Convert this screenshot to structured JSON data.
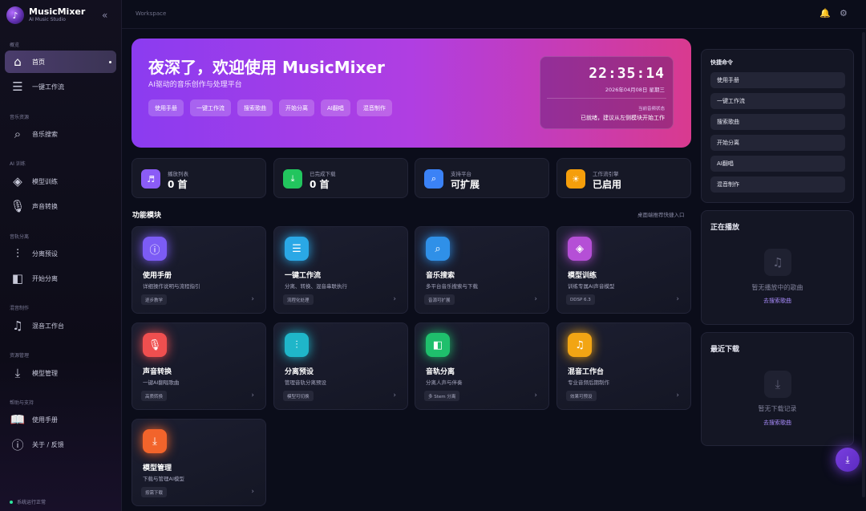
{
  "brand": {
    "name": "MusicMixer",
    "sub": "AI Music Studio"
  },
  "sidebar": {
    "sections": [
      "概览",
      "音乐资源",
      "AI 训练",
      "音轨分离",
      "混音制作",
      "资源管理",
      "帮助与支持"
    ],
    "items": [
      {
        "label": "首页",
        "icon": "home-icon",
        "active": true
      },
      {
        "label": "一键工作流",
        "icon": "workflow-icon"
      },
      {
        "label": "音乐搜索",
        "icon": "search-icon"
      },
      {
        "label": "模型训练",
        "icon": "layers-icon"
      },
      {
        "label": "声音转换",
        "icon": "mic-icon"
      },
      {
        "label": "分离预设",
        "icon": "sliders-icon"
      },
      {
        "label": "开始分离",
        "icon": "split-icon"
      },
      {
        "label": "混音工作台",
        "icon": "music-note-icon"
      },
      {
        "label": "模型管理",
        "icon": "download-icon"
      },
      {
        "label": "使用手册",
        "icon": "book-icon"
      },
      {
        "label": "关于 / 反馈",
        "icon": "info-icon"
      }
    ],
    "status": "系统运行正常"
  },
  "topbar": {
    "workspace": "Workspace"
  },
  "hero": {
    "title": "夜深了，欢迎使用 MusicMixer",
    "subtitle": "AI驱动的音乐创作与处理平台",
    "buttons": [
      "使用手册",
      "一键工作流",
      "搜索歌曲",
      "开始分离",
      "AI翻唱",
      "混音制作"
    ],
    "clock": {
      "time": "22:35:14",
      "date": "2026年04月08日 星期三",
      "label": "当前音频状态",
      "status": "已就绪，建议从左侧模块开始工作"
    }
  },
  "stats": [
    {
      "label": "播放列表",
      "value": "0 首",
      "icon": "music-icon",
      "color": "#8b5cf6"
    },
    {
      "label": "已完成下载",
      "value": "0 首",
      "icon": "download-icon",
      "color": "#22c55e"
    },
    {
      "label": "支持平台",
      "value": "可扩展",
      "icon": "search-icon",
      "color": "#3b82f6"
    },
    {
      "label": "工作流引擎",
      "value": "已启用",
      "icon": "bulb-icon",
      "color": "#f59e0b"
    }
  ],
  "features_section": {
    "title": "功能模块",
    "hint": "桌面端推荐快捷入口"
  },
  "features": [
    {
      "title": "使用手册",
      "desc": "详细操作说明与流程指引",
      "tag": "逐步教学",
      "icon": "info-icon",
      "color": "#7c5cf5"
    },
    {
      "title": "一键工作流",
      "desc": "分离、转换、混音串联执行",
      "tag": "流程化处理",
      "icon": "workflow-icon",
      "color": "#2aa8e6"
    },
    {
      "title": "音乐搜索",
      "desc": "多平台音乐搜索与下载",
      "tag": "音源可扩展",
      "icon": "search-icon",
      "color": "#2f90e8"
    },
    {
      "title": "模型训练",
      "desc": "训练专属AI声音模型",
      "tag": "DDSP 6.3",
      "icon": "layers-icon",
      "color": "#b54fd6"
    },
    {
      "title": "声音转换",
      "desc": "一键AI翻唱歌曲",
      "tag": "高质转换",
      "icon": "mic-icon",
      "color": "#ef4f4f"
    },
    {
      "title": "分离预设",
      "desc": "管理音轨分离预设",
      "tag": "模型可切换",
      "icon": "sliders-icon",
      "color": "#1fb6c9"
    },
    {
      "title": "音轨分离",
      "desc": "分离人声与伴奏",
      "tag": "多 Stem 分离",
      "icon": "split-icon",
      "color": "#1fbf6c"
    },
    {
      "title": "混音工作台",
      "desc": "专业音频后期制作",
      "tag": "效果可预设",
      "icon": "music-note-icon",
      "color": "#f2a514"
    },
    {
      "title": "模型管理",
      "desc": "下载与管理AI模型",
      "tag": "按需下载",
      "icon": "download-icon",
      "color": "#f2642b"
    }
  ],
  "quick": {
    "title": "快捷命令",
    "items": [
      "使用手册",
      "一键工作流",
      "搜索歌曲",
      "开始分离",
      "AI翻唱",
      "混音制作"
    ]
  },
  "now_playing": {
    "title": "正在播放",
    "empty": "暂无播放中的歌曲",
    "link": "去搜索歌曲"
  },
  "recent": {
    "title": "最近下载",
    "empty": "暂无下载记录",
    "link": "去搜索歌曲"
  }
}
